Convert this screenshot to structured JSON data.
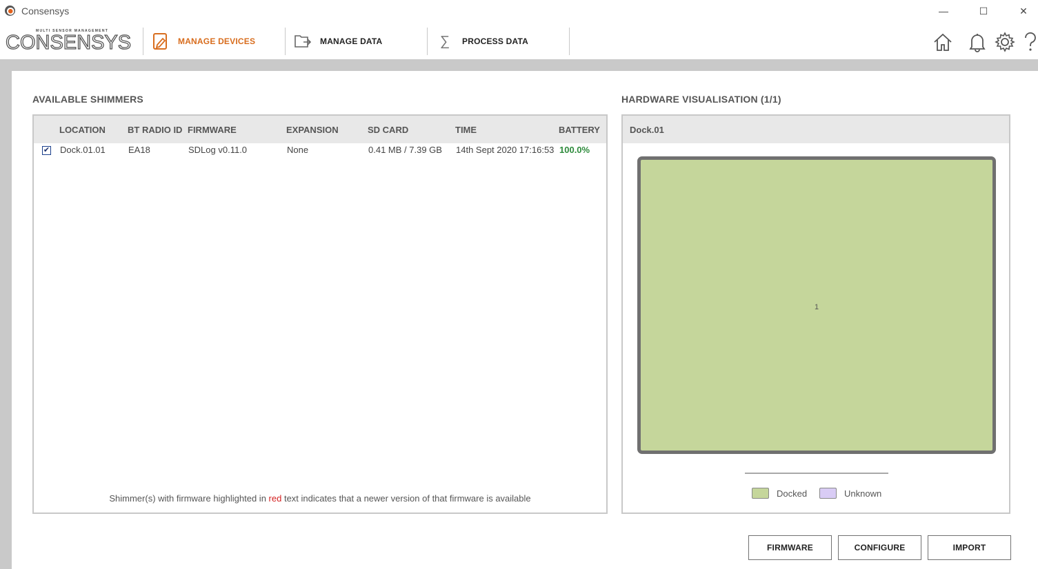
{
  "window": {
    "title": "Consensys",
    "minimize_glyph": "—",
    "maximize_glyph": "☐",
    "close_glyph": "✕"
  },
  "logo": {
    "tagline": "MULTI SENSOR MANAGEMENT",
    "name": "CONSENSYS"
  },
  "nav": {
    "items": [
      {
        "label": "MANAGE DEVICES",
        "icon": "manage-devices-icon",
        "active": true
      },
      {
        "label": "MANAGE DATA",
        "icon": "folder-export-icon",
        "active": false
      },
      {
        "label": "PROCESS DATA",
        "icon": "sigma-icon",
        "active": false
      }
    ],
    "sigma_glyph": "∑",
    "right_icons": [
      "home-icon",
      "bell-icon",
      "gear-icon",
      "help-icon"
    ]
  },
  "shimmers": {
    "title": "AVAILABLE SHIMMERS",
    "columns": [
      "LOCATION",
      "BT RADIO ID",
      "FIRMWARE",
      "EXPANSION",
      "SD CARD",
      "TIME",
      "BATTERY"
    ],
    "rows": [
      {
        "checked": true,
        "check_glyph": "✔",
        "location": "Dock.01.01",
        "bt_radio_id": "EA18",
        "firmware": "SDLog v0.11.0",
        "expansion": "None",
        "sd_card": "0.41 MB / 7.39 GB",
        "time": "14th Sept 2020 17:16:53",
        "battery": "100.0%"
      }
    ],
    "footnote_before": "Shimmer(s) with firmware highlighted in ",
    "footnote_red": "red",
    "footnote_after": " text indicates that a newer version of that firmware is available"
  },
  "hardware": {
    "title": "HARDWARE VISUALISATION (1/1)",
    "dock_label": "Dock.01",
    "slot_number": "1",
    "legend": [
      {
        "label": "Docked",
        "color": "#c5d69b"
      },
      {
        "label": "Unknown",
        "color": "#d9ccf5"
      }
    ]
  },
  "buttons": {
    "firmware": "FIRMWARE",
    "configure": "CONFIGURE",
    "import": "IMPORT"
  },
  "colors": {
    "accent": "#d86d1e",
    "battery_ok": "#2e8b3c",
    "docked": "#c5d69b",
    "unknown": "#d9ccf5"
  }
}
